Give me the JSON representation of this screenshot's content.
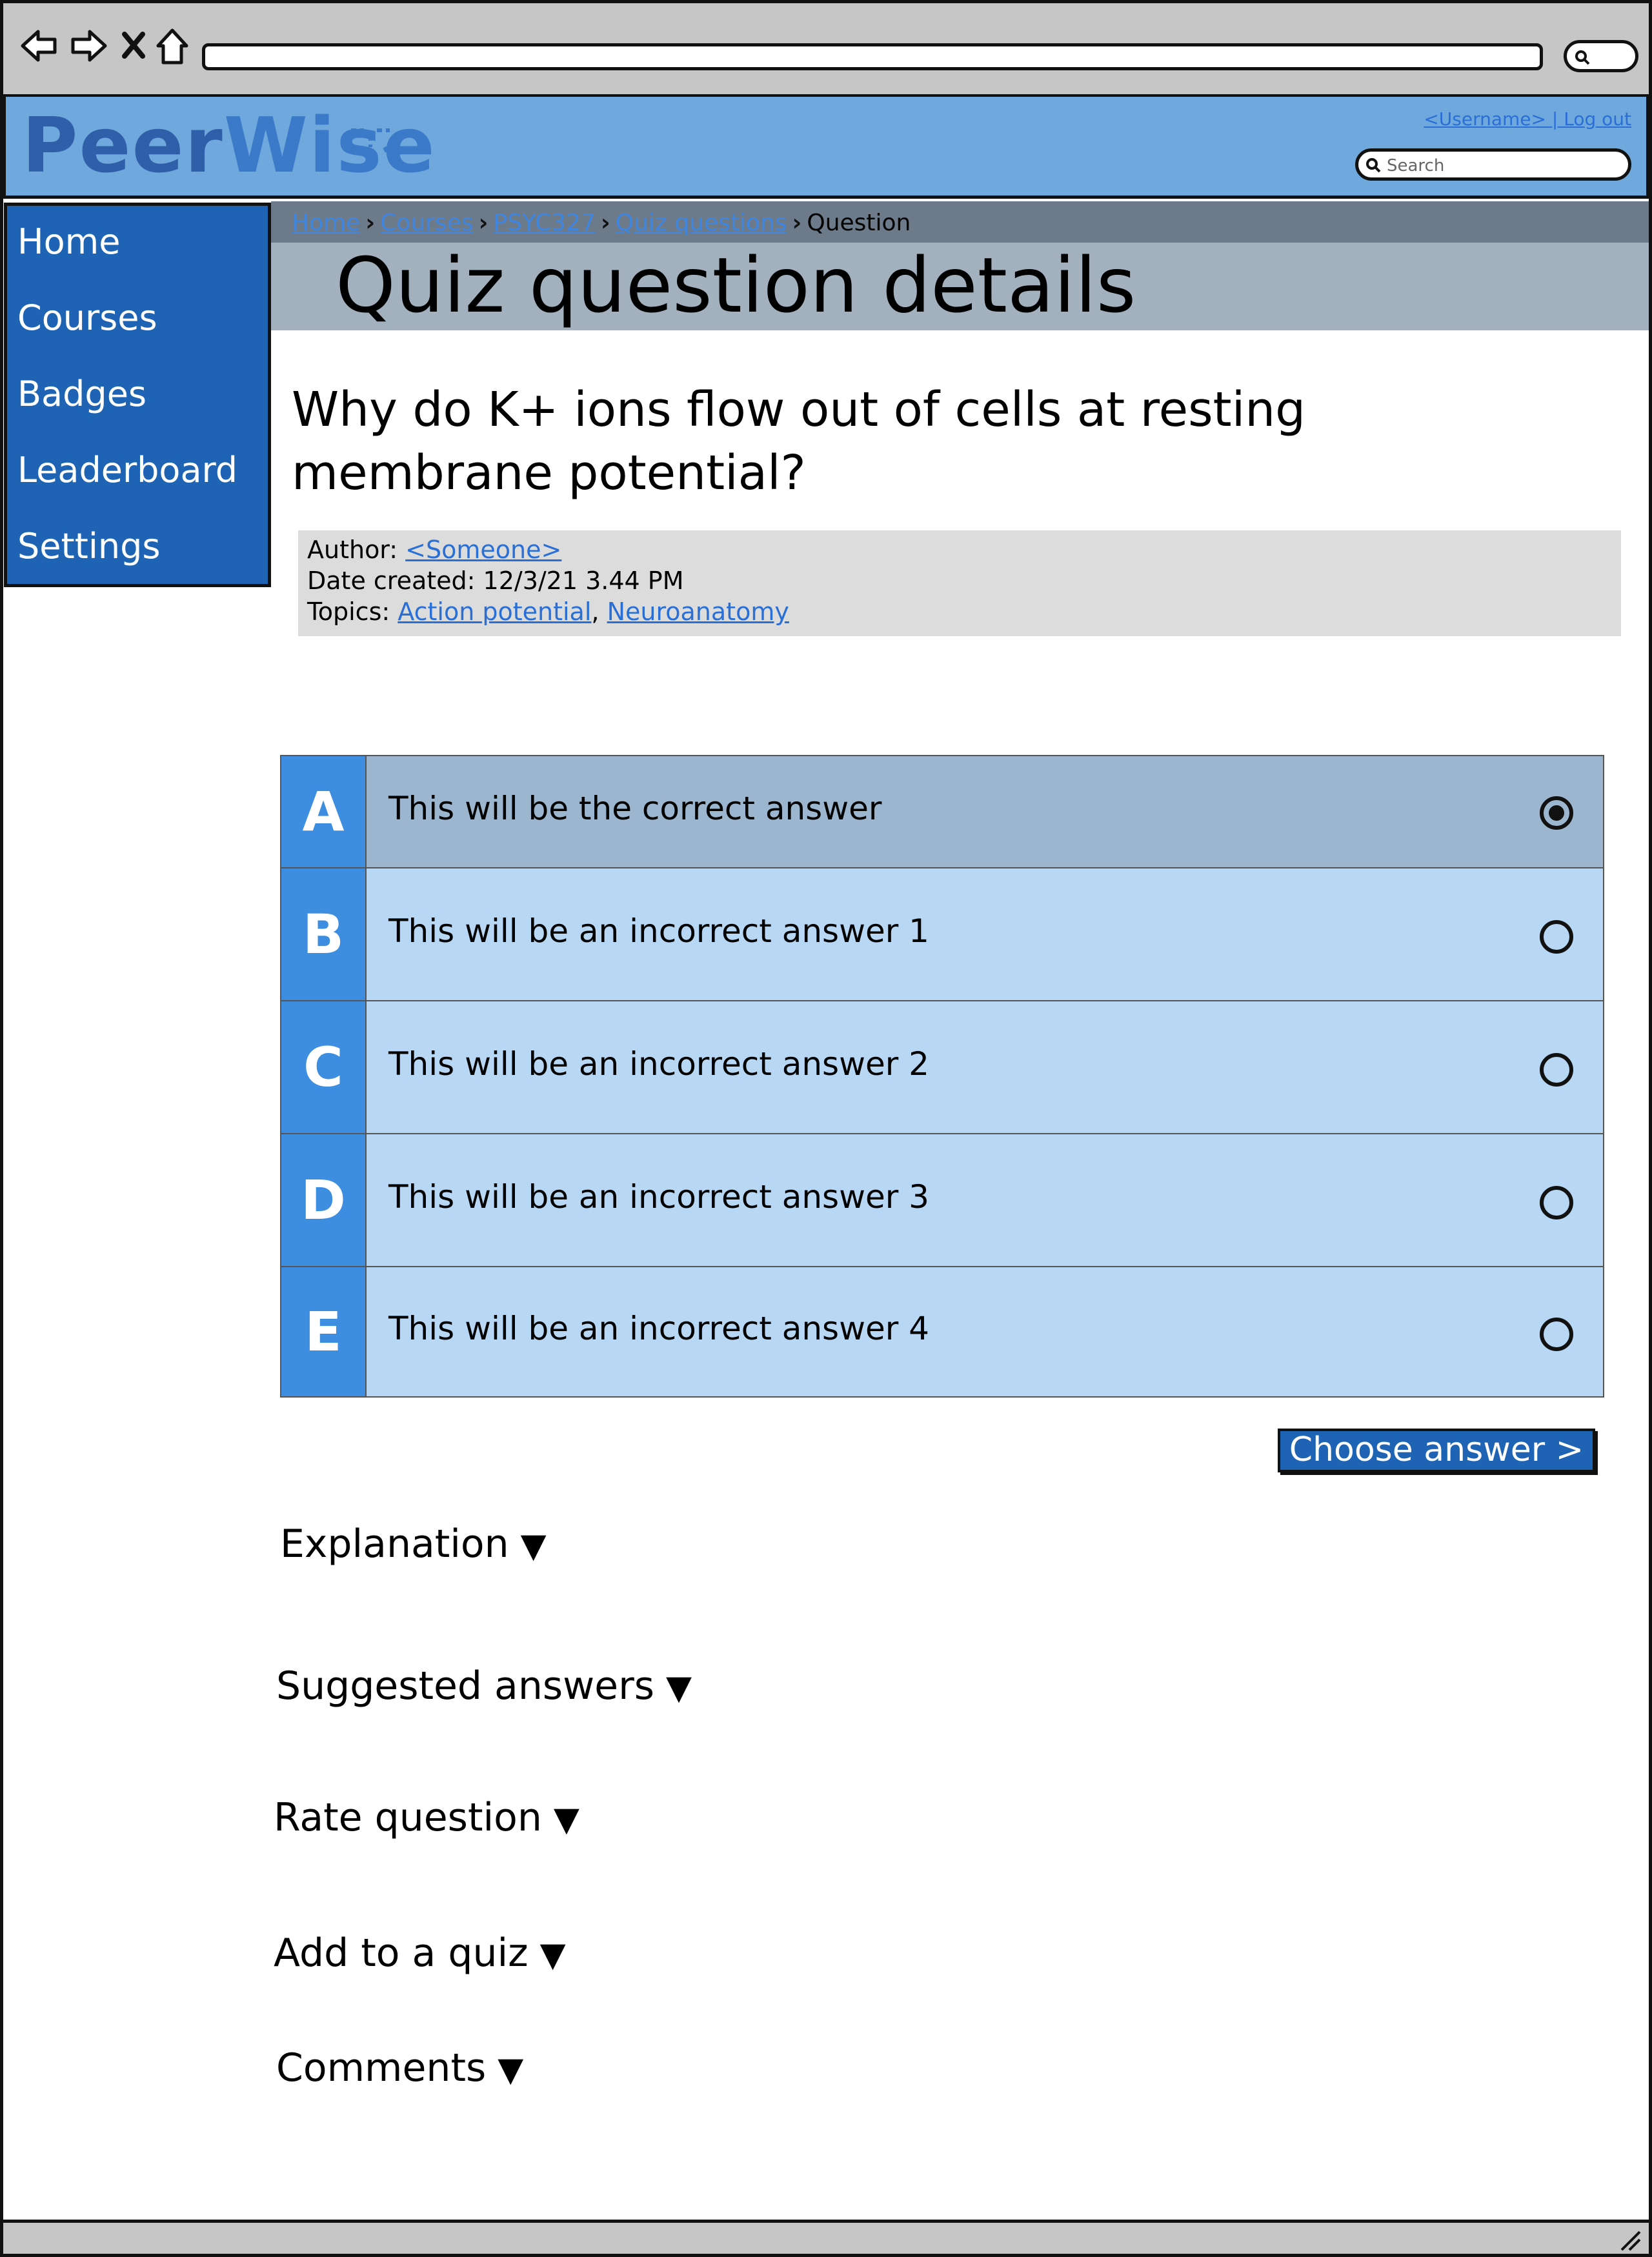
{
  "header": {
    "logo_part1": "Peer",
    "logo_part2": "Wise",
    "user_links": "<Username> | Log out",
    "search_placeholder": "Search"
  },
  "sidebar": {
    "items": [
      {
        "label": "Home"
      },
      {
        "label": "Courses"
      },
      {
        "label": "Badges"
      },
      {
        "label": "Leaderboard"
      },
      {
        "label": "Settings"
      }
    ]
  },
  "breadcrumb": {
    "items": [
      "Home",
      "Courses",
      "PSYC327",
      "Quiz questions"
    ],
    "current": "Question",
    "separator": "›"
  },
  "page": {
    "title": "Quiz question details",
    "question": "Why do K+ ions flow out of cells at resting membrane potential?"
  },
  "meta": {
    "author_label": "Author:",
    "author": "<Someone>",
    "date_label": "Date created:",
    "date": "12/3/21 3.44 PM",
    "topics_label": "Topics:",
    "topics": [
      "Action potential",
      "Neuroanatomy"
    ],
    "topic_separator": ","
  },
  "answers": [
    {
      "letter": "A",
      "text": "This will be the correct answer",
      "selected": true
    },
    {
      "letter": "B",
      "text": "This will be an incorrect answer 1",
      "selected": false
    },
    {
      "letter": "C",
      "text": "This will be an incorrect answer 2",
      "selected": false
    },
    {
      "letter": "D",
      "text": "This will be an incorrect answer 3",
      "selected": false
    },
    {
      "letter": "E",
      "text": "This will be an incorrect answer 4",
      "selected": false
    }
  ],
  "choose_button": "Choose answer >",
  "sections": [
    {
      "label": "Explanation",
      "icon": "▼"
    },
    {
      "label": "Suggested answers",
      "icon": "▼"
    },
    {
      "label": "Rate question",
      "icon": "▼"
    },
    {
      "label": "Add to a quiz",
      "icon": "▼"
    },
    {
      "label": "Comments",
      "icon": "▼"
    }
  ],
  "colors": {
    "header": "#6fa8dc",
    "sidebar": "#1e63b4",
    "answer_selected": "#9db6cf",
    "answer_default": "#b7d7f5",
    "letter_bg": "#3d8de0"
  }
}
